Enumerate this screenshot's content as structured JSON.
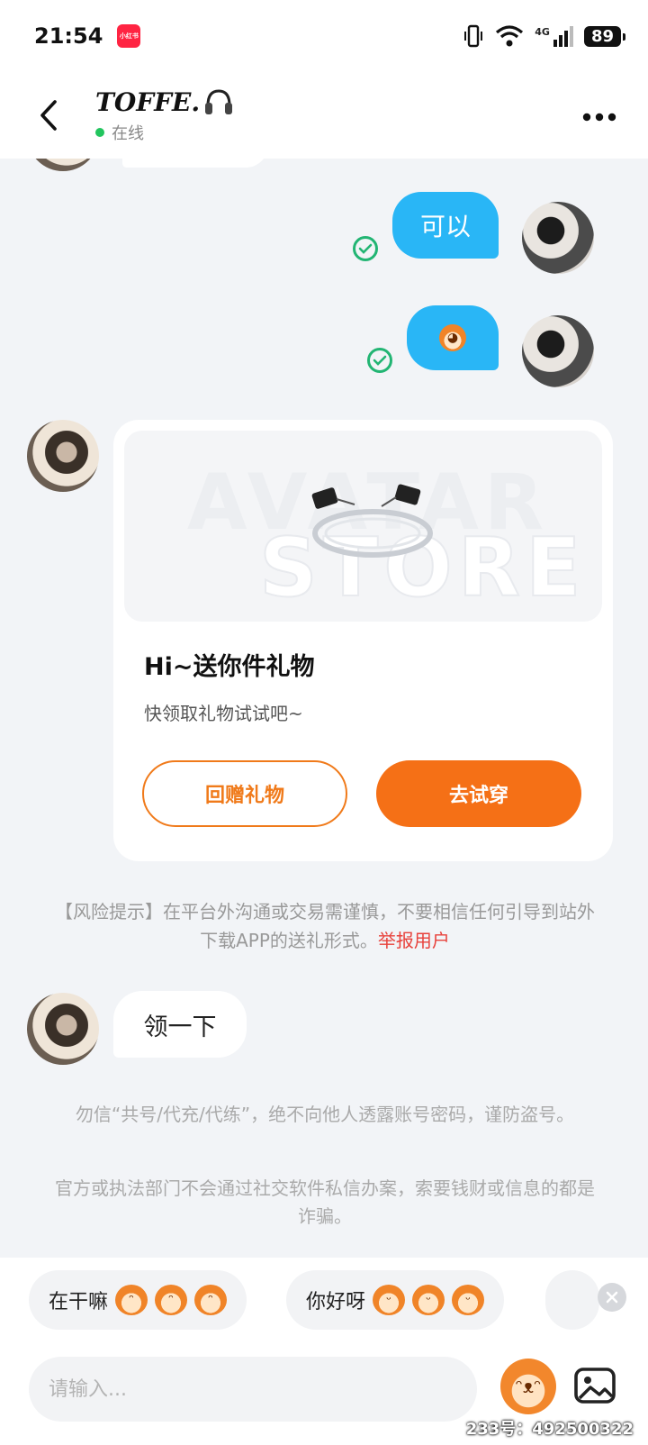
{
  "status_bar": {
    "time": "21:54",
    "app_badge": "小红书",
    "network": "4G",
    "battery": "89"
  },
  "header": {
    "title": "TOFFE.",
    "title_icon": "headphones-icon",
    "status": "在线"
  },
  "messages": {
    "m1": {
      "text": "可以",
      "sender": "me"
    },
    "m2": {
      "sticker": "monkey-face",
      "sender": "me"
    },
    "gift_card": {
      "watermark_top": "AVATAR",
      "watermark_bottom": "STORE",
      "title": "Hi~送你件礼物",
      "subtitle": "快领取礼物试试吧~",
      "btn_return": "回赠礼物",
      "btn_try": "去试穿"
    },
    "risk": {
      "text": "【风险提示】在平台外沟通或交易需谨慎，不要相信任何引导到站外下载APP的送礼形式。",
      "link": "举报用户"
    },
    "m3": {
      "text": "领一下",
      "sender": "other"
    },
    "notice1": "勿信“共号/代充/代练”，绝不向他人透露账号密码，谨防盗号。",
    "notice2": "官方或执法部门不会通过社交软件私信办案，索要钱财或信息的都是诈骗。"
  },
  "quick_replies": [
    {
      "text": "在干嘛"
    },
    {
      "text": "你好呀"
    }
  ],
  "input": {
    "placeholder": "请输入..."
  },
  "watermark": "233号：492500322",
  "colors": {
    "outgoing_bubble": "#29b6f6",
    "accent_orange": "#f57016",
    "online_green": "#22c55e",
    "report_red": "#e8413b"
  }
}
